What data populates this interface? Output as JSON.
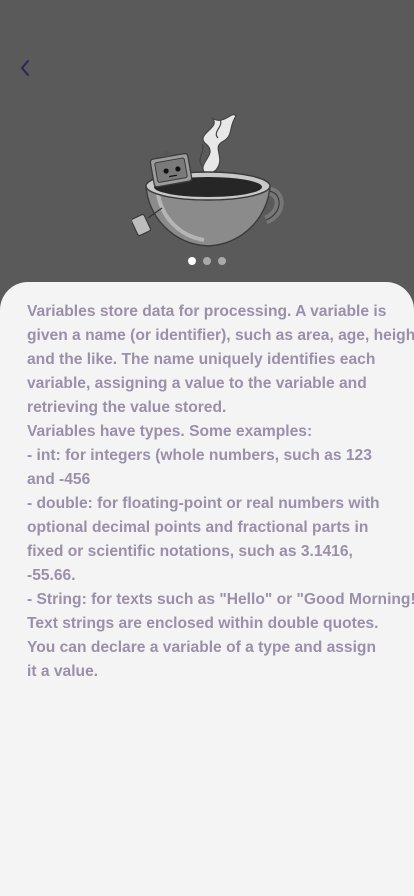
{
  "nav": {
    "back_icon": "chevron-left-icon"
  },
  "illustration": {
    "icon": "coffee-cup-robot-illustration"
  },
  "pager": {
    "count": 3,
    "active_index": 0
  },
  "colors": {
    "header_bg": "#5a5a5a",
    "card_bg": "#f4f4f4",
    "text": "#9a90aa",
    "back_icon": "#2d2456"
  },
  "content": {
    "lines": [
      "Variables store data for processing. A variable is",
      "given a name (or identifier), such as area, age, height,",
      "and the like. The name uniquely identifies each",
      "variable, assigning a value to the variable and",
      "retrieving the value stored.",
      "Variables have types. Some examples:",
      "- int: for integers (whole numbers, such as 123",
      "and -456",
      "- double: for floating-point or real numbers with",
      "optional decimal points and fractional parts in",
      "fixed or scientific notations, such as 3.1416,",
      "-55.66.",
      "- String: for texts such as \"Hello\" or \"Good Morning!\".",
      "Text strings are enclosed within double quotes.",
      "You can declare a variable of a type and assign",
      "it a value."
    ]
  }
}
